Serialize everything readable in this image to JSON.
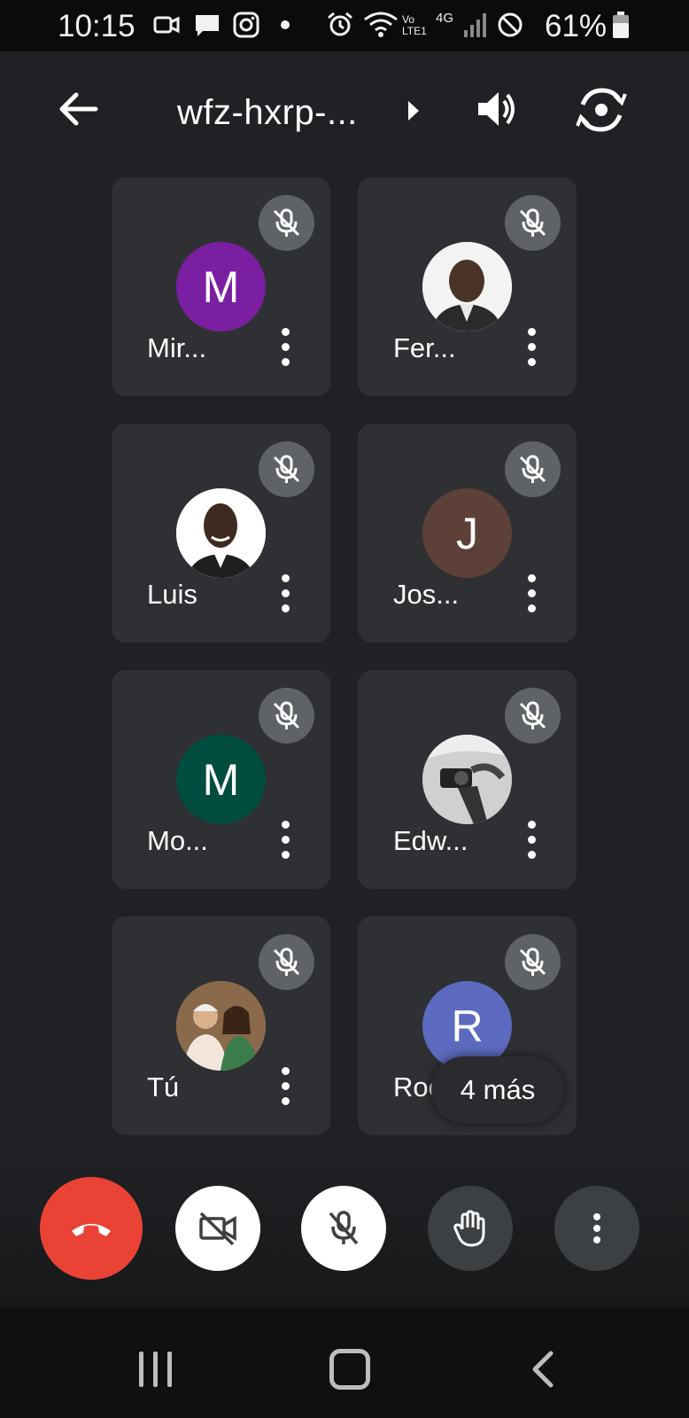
{
  "status_bar": {
    "time": "10:15",
    "network_text": "Vo LTE1",
    "network_type": "4G",
    "battery_percent": "61%",
    "icons": [
      "video-icon",
      "message-icon",
      "instagram-icon",
      "dot-icon",
      "alarm-icon",
      "wifi-icon",
      "signal-icon",
      "block-icon",
      "battery-icon"
    ]
  },
  "top_bar": {
    "meeting_code": "wfz-hxrp-...",
    "icons": [
      "back-arrow-icon",
      "caret-right-icon",
      "speaker-icon",
      "switch-camera-icon"
    ]
  },
  "participants": [
    {
      "name": "Mir...",
      "initial": "M",
      "avatar_color": "#7b1fa2",
      "avatar_type": "initial",
      "muted": true
    },
    {
      "name": "Fer...",
      "initial": "",
      "avatar_color": "#ffffff",
      "avatar_type": "photo",
      "muted": true
    },
    {
      "name": "Luis",
      "initial": "",
      "avatar_color": "#ffffff",
      "avatar_type": "photo",
      "muted": true
    },
    {
      "name": "Jos...",
      "initial": "J",
      "avatar_color": "#5d4037",
      "avatar_type": "initial",
      "muted": true
    },
    {
      "name": "Mo...",
      "initial": "M",
      "avatar_color": "#004d40",
      "avatar_type": "initial",
      "muted": true
    },
    {
      "name": "Edw...",
      "initial": "",
      "avatar_color": "#9e9e9e",
      "avatar_type": "photo",
      "muted": true
    },
    {
      "name": "Tú",
      "initial": "",
      "avatar_color": "#c8a27a",
      "avatar_type": "photo",
      "muted": true
    },
    {
      "name": "Rocí",
      "initial": "R",
      "avatar_color": "#5c6bc0",
      "avatar_type": "initial",
      "muted": true
    }
  ],
  "more_participants_label": "4 más",
  "controls": {
    "end_call_color": "#ea4335",
    "icons": [
      "hang-up-icon",
      "camera-off-icon",
      "mic-off-icon",
      "raise-hand-icon",
      "more-vert-icon"
    ]
  },
  "nav_bar": {
    "icons": [
      "recents-icon",
      "home-icon",
      "back-icon"
    ]
  }
}
